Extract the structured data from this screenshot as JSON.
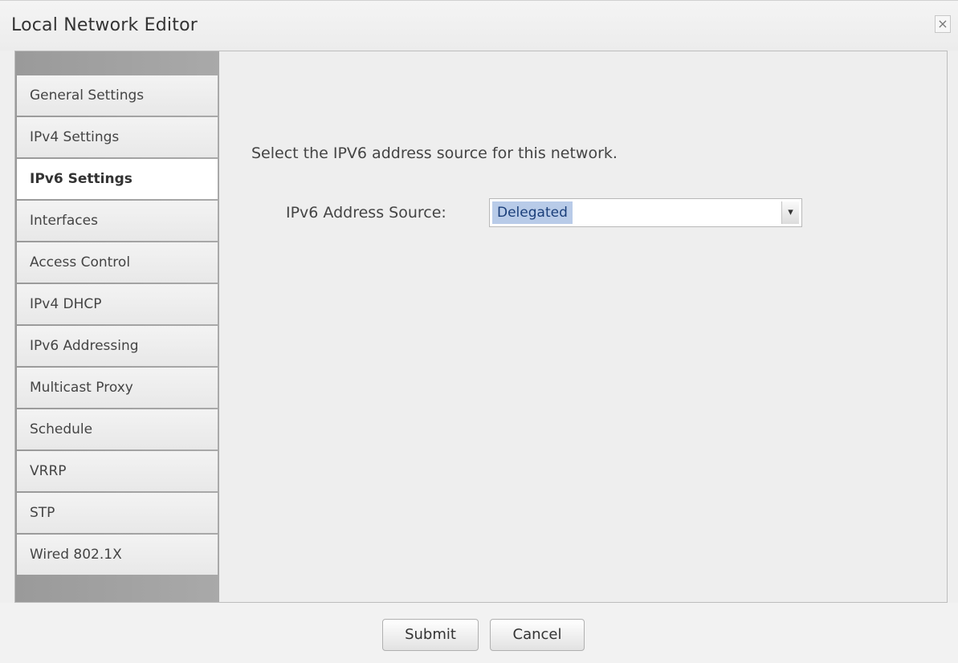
{
  "window": {
    "title": "Local Network Editor",
    "close_label": "×"
  },
  "sidebar": {
    "items": [
      {
        "label": "General Settings",
        "active": false
      },
      {
        "label": "IPv4 Settings",
        "active": false
      },
      {
        "label": "IPv6 Settings",
        "active": true
      },
      {
        "label": "Interfaces",
        "active": false
      },
      {
        "label": "Access Control",
        "active": false
      },
      {
        "label": "IPv4 DHCP",
        "active": false
      },
      {
        "label": "IPv6 Addressing",
        "active": false
      },
      {
        "label": "Multicast Proxy",
        "active": false
      },
      {
        "label": "Schedule",
        "active": false
      },
      {
        "label": "VRRP",
        "active": false
      },
      {
        "label": "STP",
        "active": false
      },
      {
        "label": "Wired 802.1X",
        "active": false
      }
    ]
  },
  "main": {
    "description": "Select the IPV6 address source for this network.",
    "address_source": {
      "label": "IPv6 Address Source:",
      "selected": "Delegated",
      "arrow_icon": "chevron-down-icon"
    }
  },
  "footer": {
    "submit_label": "Submit",
    "cancel_label": "Cancel"
  }
}
